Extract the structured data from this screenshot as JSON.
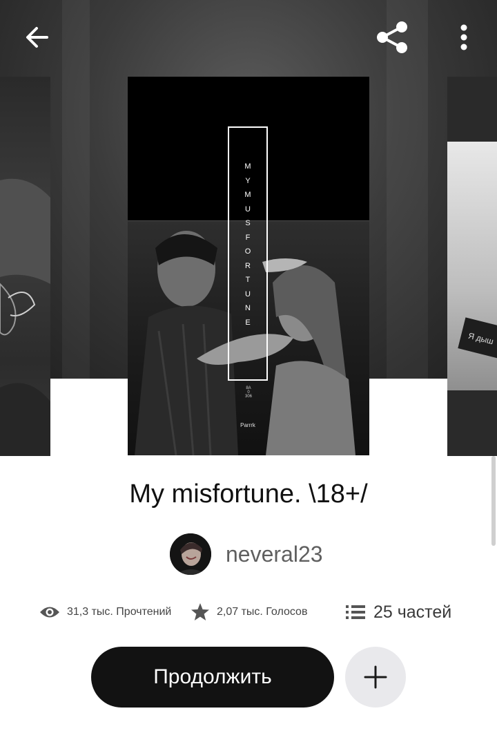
{
  "header": {
    "back_icon": "arrow-left-icon",
    "share_icon": "share-icon",
    "more_icon": "more-vertical-icon"
  },
  "cover": {
    "letters": [
      "M",
      "Y",
      "M",
      "U",
      "S",
      "F",
      "O",
      "R",
      "T",
      "U",
      "N",
      "E"
    ],
    "small_text_1": "8A",
    "small_text_2": "0",
    "small_text_3": "306",
    "author_mark": "Parrrk"
  },
  "side_covers": {
    "right_sign_text": "Я дыш"
  },
  "story": {
    "title": "My misfortune. \\18+/",
    "author": "neveral23"
  },
  "stats": {
    "reads_icon": "eye-icon",
    "reads": "31,3 тыс. Прочтений",
    "votes_icon": "star-icon",
    "votes": "2,07 тыс. Голосов",
    "parts_icon": "list-icon",
    "parts": "25 частей"
  },
  "actions": {
    "continue_label": "Продолжить",
    "add_icon": "plus-icon"
  },
  "colors": {
    "primary_button": "#121212",
    "secondary_button": "#e9e9ec",
    "hero_background": "#3b3b3b"
  }
}
